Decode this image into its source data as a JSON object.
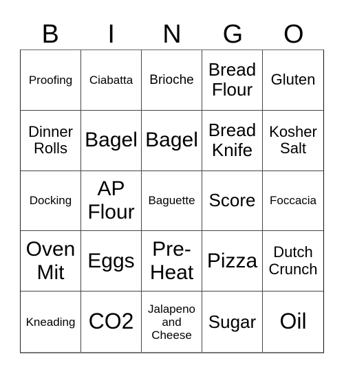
{
  "header": {
    "letters": [
      "B",
      "I",
      "N",
      "G",
      "O"
    ]
  },
  "board": {
    "rows": [
      [
        "Proofing",
        "Ciabatta",
        "Brioche",
        "Bread Flour",
        "Gluten"
      ],
      [
        "Dinner Rolls",
        "Bagel",
        "Bagel",
        "Bread Knife",
        "Kosher Salt"
      ],
      [
        "Docking",
        "AP Flour",
        "Baguette",
        "Score",
        "Foccacia"
      ],
      [
        "Oven Mit",
        "Eggs",
        "Pre-Heat",
        "Pizza",
        "Dutch Crunch"
      ],
      [
        "Kneading",
        "CO2",
        "Jalapeno and Cheese",
        "Sugar",
        "Oil"
      ]
    ]
  },
  "colors": {
    "background": "#ffffff",
    "text": "#000000",
    "grid_lines": "#444444"
  }
}
